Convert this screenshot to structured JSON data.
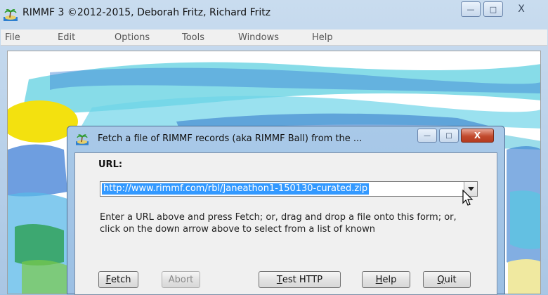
{
  "main_window": {
    "title": "RIMMF 3   ©2012-2015, Deborah Fritz, Richard Fritz",
    "controls": {
      "minimize": "—",
      "maximize": "□",
      "close": "X"
    }
  },
  "menubar": {
    "items": [
      "File",
      "Edit",
      "Options",
      "Tools",
      "Windows",
      "Help"
    ]
  },
  "dialog": {
    "title": "Fetch a file of RIMMF records (aka RIMMF Ball) from the ...",
    "controls": {
      "minimize": "—",
      "maximize": "□",
      "close": "X"
    },
    "url_label": "URL:",
    "url_value": "http://www.rimmf.com/rbl/Janeathon1-150130-curated.zip",
    "help_text": "Enter a URL above and press Fetch; or, drag and drop a file onto this form; or, click on the down arrow above to select from a list of known",
    "buttons": {
      "fetch": {
        "first": "F",
        "rest": "etch"
      },
      "abort": "Abort",
      "test_http": {
        "first": "T",
        "rest": "est HTTP"
      },
      "help": {
        "first": "H",
        "rest": "elp"
      },
      "quit": {
        "first": "Q",
        "rest": "uit"
      }
    }
  },
  "icons": {
    "app": "palm-tree-island-icon",
    "dropdown": "chevron-down-icon",
    "cursor": "mouse-pointer-icon"
  },
  "colors": {
    "selection": "#3399ff",
    "close_button": "#c24a2e",
    "title_bar": "#a9c9e8"
  }
}
